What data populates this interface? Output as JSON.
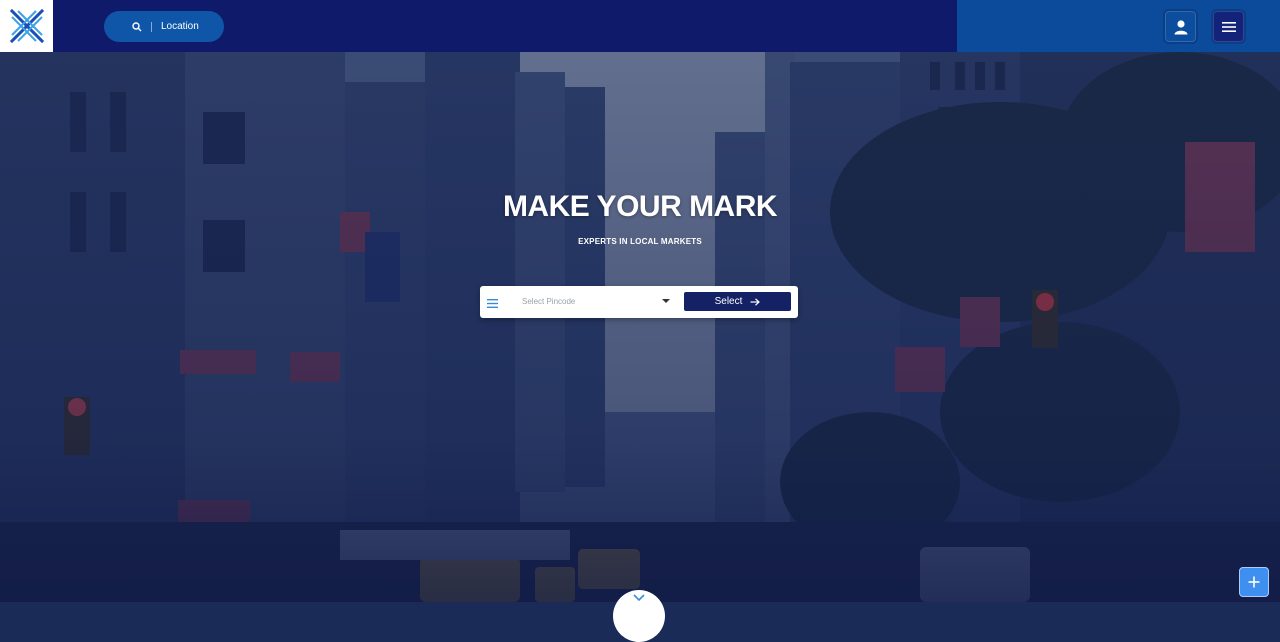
{
  "header": {
    "location_label": "Location"
  },
  "hero": {
    "title": "MAKE YOUR MARK",
    "subtitle": "EXPERTS IN LOCAL MARKETS"
  },
  "search": {
    "pincode_placeholder": "Select Pincode",
    "select_label": "Select"
  },
  "icons": {
    "logo": "x-logo-icon",
    "location": "search-icon",
    "user": "user-icon",
    "menu": "hamburger-menu-icon",
    "filter": "list-filter-icon",
    "arrow": "arrow-right-icon",
    "scroll": "chevron-down-icon",
    "fab": "plus-icon"
  },
  "colors": {
    "header_bg": "#101a6b",
    "header_right_bg": "#0c4b9c",
    "pill_bg": "#0f56a8",
    "select_button_bg": "#142165",
    "fab_bg": "#3f8ff0"
  }
}
